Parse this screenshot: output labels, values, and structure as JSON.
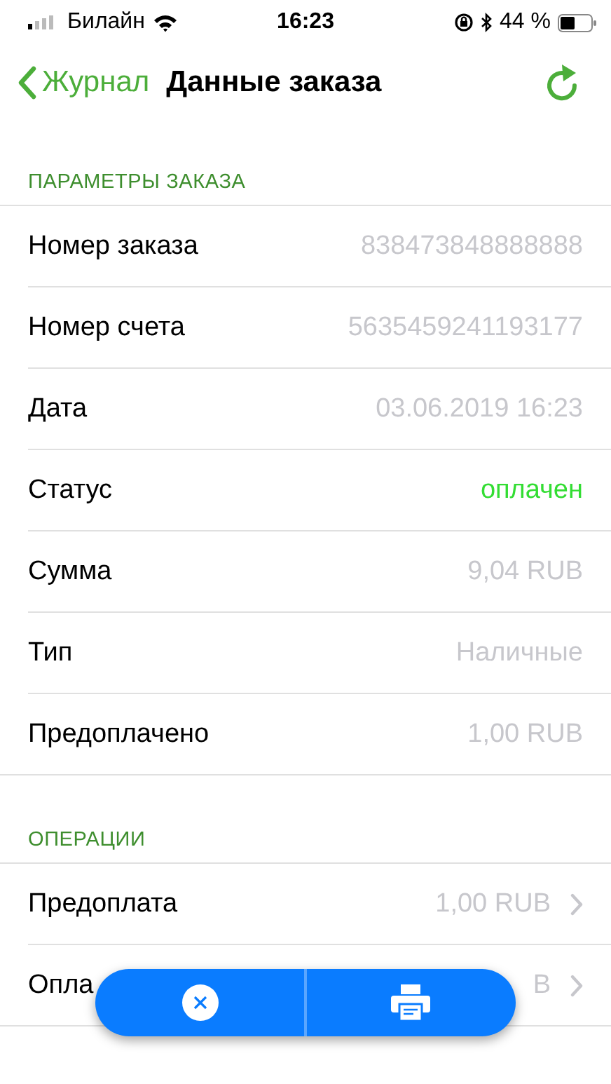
{
  "status_bar": {
    "carrier": "Билайн",
    "time": "16:23",
    "battery": "44 %"
  },
  "nav": {
    "back": "Журнал",
    "title": "Данные заказа"
  },
  "sections": [
    {
      "header": "ПАРАМЕТРЫ ЗАКАЗА",
      "rows": [
        {
          "label": "Номер заказа",
          "value": "838473848888888",
          "color": "#c7c7cc",
          "chevron": false
        },
        {
          "label": "Номер счета",
          "value": "5635459241193177",
          "color": "#c7c7cc",
          "chevron": false
        },
        {
          "label": "Дата",
          "value": "03.06.2019 16:23",
          "color": "#c7c7cc",
          "chevron": false
        },
        {
          "label": "Статус",
          "value": "оплачен",
          "color": "#33dd33",
          "chevron": false
        },
        {
          "label": "Сумма",
          "value": "9,04 RUB",
          "color": "#c7c7cc",
          "chevron": false
        },
        {
          "label": "Тип",
          "value": "Наличные",
          "color": "#c7c7cc",
          "chevron": false
        },
        {
          "label": "Предоплачено",
          "value": "1,00 RUB",
          "color": "#c7c7cc",
          "chevron": false
        }
      ]
    },
    {
      "header": "ОПЕРАЦИИ",
      "rows": [
        {
          "label": "Предоплата",
          "value": "1,00 RUB",
          "color": "#c7c7cc",
          "chevron": true
        },
        {
          "label": "Опла",
          "value": "B",
          "color": "#c7c7cc",
          "chevron": true
        }
      ]
    }
  ]
}
